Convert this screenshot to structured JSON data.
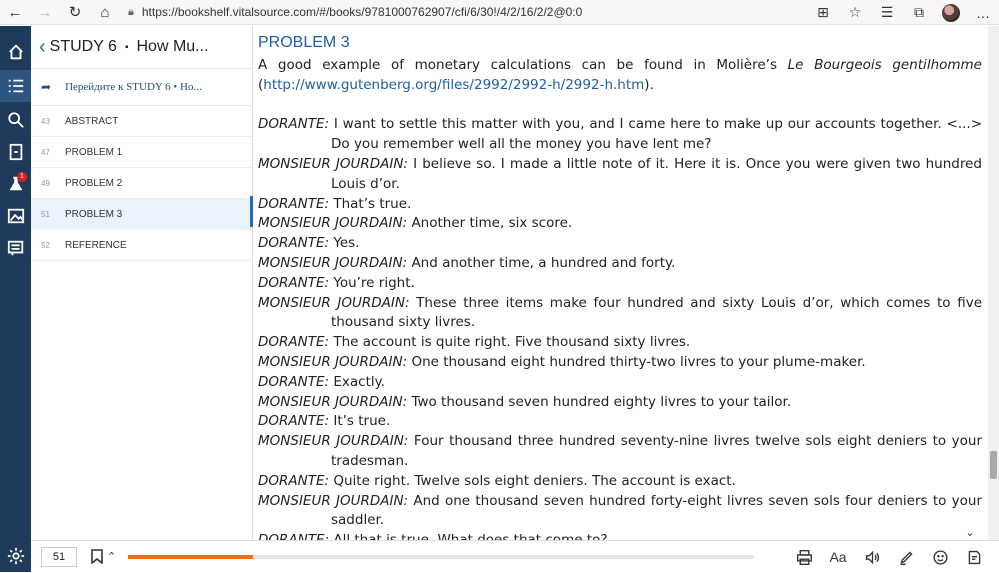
{
  "browser": {
    "url": "https://bookshelf.vitalsource.com/#/books/9781000762907/cfi/6/30!/4/2/16/2/2@0:0"
  },
  "toc": {
    "header_title": "STUDY 6",
    "header_sep": "▪",
    "header_subtitle": "How Mu...",
    "translate_label": "Перейдите к STUDY 6 • Ho...",
    "items": [
      {
        "page": "43",
        "label": "ABSTRACT"
      },
      {
        "page": "47",
        "label": "PROBLEM 1"
      },
      {
        "page": "49",
        "label": "PROBLEM 2"
      },
      {
        "page": "51",
        "label": "PROBLEM 3"
      },
      {
        "page": "52",
        "label": "REFERENCE"
      }
    ]
  },
  "content": {
    "title": "PROBLEM 3",
    "intro_before": "A good example of monetary calculations can be found in Molière’s ",
    "intro_italic": "Le Bourgeois gentilhomme",
    "intro_link_open": "(",
    "intro_link": "http://www.gutenberg.org/files/2992/2992-h/2992-h.htm",
    "intro_after": ").",
    "dialogue": [
      {
        "speaker": "DORANTE:",
        "text": "I want to settle this matter with you, and I came here to make up our accounts together. <...> Do you remember well all the money you have lent me?"
      },
      {
        "speaker": "MONSIEUR JOURDAIN:",
        "text": "I believe so. I made a little note of it. Here it is. Once you were given two hundred Louis d’or."
      },
      {
        "speaker": "DORANTE:",
        "text": "That’s true."
      },
      {
        "speaker": "MONSIEUR JOURDAIN:",
        "text": "Another time, six score."
      },
      {
        "speaker": "DORANTE:",
        "text": "Yes."
      },
      {
        "speaker": "MONSIEUR JOURDAIN:",
        "text": "And another time, a hundred and forty."
      },
      {
        "speaker": "DORANTE:",
        "text": "You’re right."
      },
      {
        "speaker": "MONSIEUR JOURDAIN:",
        "text": "These three items make four hundred and sixty Louis d’or, which comes to five thousand sixty livres."
      },
      {
        "speaker": "DORANTE:",
        "text": "The account is quite right. Five thousand sixty livres."
      },
      {
        "speaker": "MONSIEUR JOURDAIN:",
        "text": "One thousand eight hundred thirty-two livres to your plume-maker."
      },
      {
        "speaker": "DORANTE:",
        "text": "Exactly."
      },
      {
        "speaker": "MONSIEUR JOURDAIN:",
        "text": "Two thousand seven hundred eighty livres to your tailor."
      },
      {
        "speaker": "DORANTE:",
        "text": "It’s true."
      },
      {
        "speaker": "MONSIEUR JOURDAIN:",
        "text": "Four thousand three hundred seventy-nine livres twelve sols eight deniers to your tradesman."
      },
      {
        "speaker": "DORANTE:",
        "text": "Quite right. Twelve sols eight deniers. The account is exact."
      },
      {
        "speaker": "MONSIEUR JOURDAIN:",
        "text": "And one thousand seven hundred forty-eight livres seven sols four deniers to your saddler."
      },
      {
        "speaker": "DORANTE:",
        "text": "All that is true. What does that come to?"
      }
    ]
  },
  "rail": {
    "badge_count": "1"
  },
  "bottom": {
    "page_number": "51",
    "progress_fraction": 0.2,
    "font_tool_label": "Aa"
  },
  "colors": {
    "rail_bg": "#1f3a5a",
    "accent_blue": "#1f5fa0",
    "progress_orange": "#e8701a"
  }
}
